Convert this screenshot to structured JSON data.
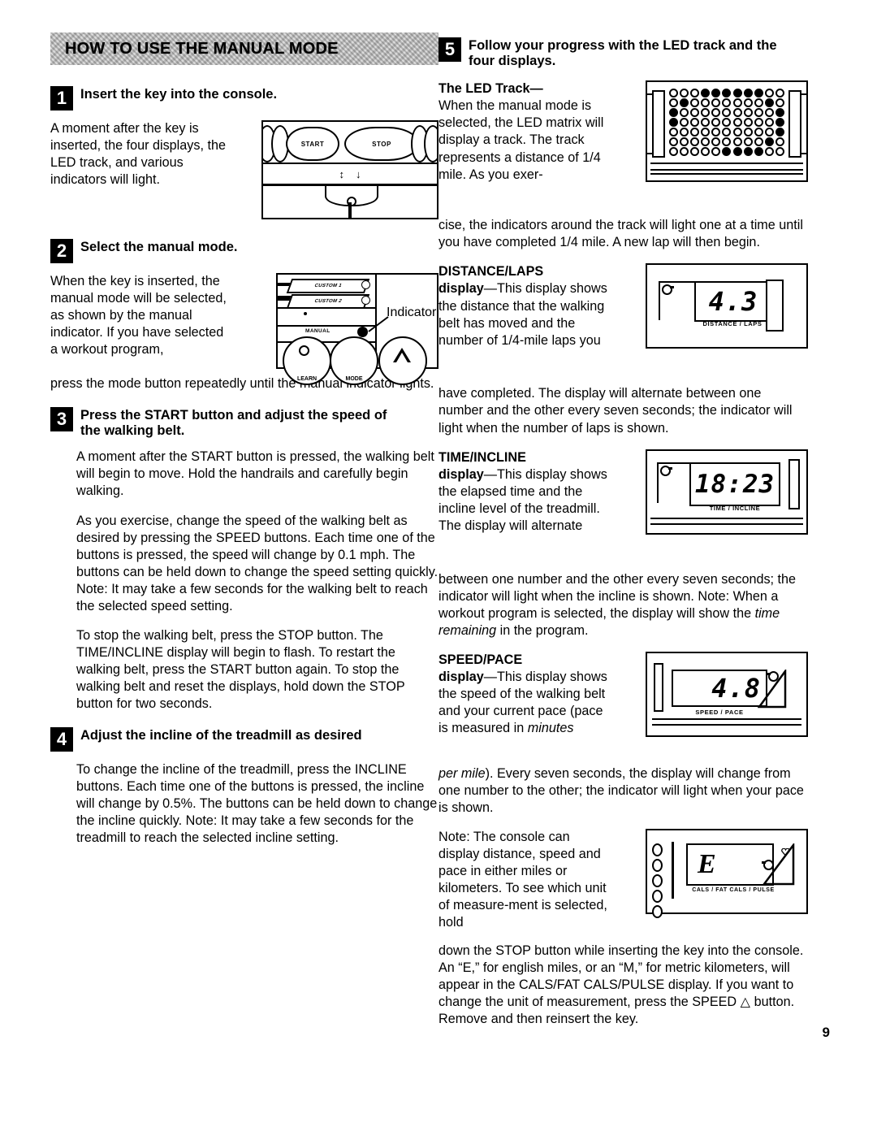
{
  "banner": {
    "title": "HOW TO USE THE MANUAL MODE"
  },
  "page_number": "9",
  "left_column": {
    "step1": {
      "number": "1",
      "title": "Insert the key into the console.",
      "paragraph": "A moment after the key is inserted, the four displays, the LED track, and various indicators will light.",
      "figure": {
        "name": "console-start-stop-figure",
        "start_label": "START",
        "stop_label": "STOP",
        "up_arrow": "↕",
        "down_arrow": "↓"
      }
    },
    "step2": {
      "number": "2",
      "title": "Select the manual mode.",
      "paragraph_narrow": "When the key is inserted, the manual mode will be selected, as shown by the manual indicator. If you have selected a workout program,",
      "paragraph_wide": "press the mode button repeatedly until the manual indicator lights.",
      "figure": {
        "name": "manual-indicator-figure",
        "custom1_label": "CUSTOM 1",
        "custom2_label": "CUSTOM 2",
        "manual_label": "MANUAL",
        "indicator_callout": "Indicator",
        "learn_label": "LEARN",
        "mode_label": "MODE"
      }
    },
    "step3": {
      "number": "3",
      "title": "Press the START button and adjust the speed of the walking belt.",
      "paragraph1": "A moment after the START button is pressed, the walking belt will begin to move. Hold the handrails and carefully begin walking.",
      "paragraph2": "As you exercise, change the speed of the walking belt as desired by pressing the SPEED buttons. Each time one of the buttons is pressed, the speed will change by 0.1 mph. The buttons can be held down to change the speed setting quickly. Note: It may take a few seconds for the walking belt to reach the selected speed setting.",
      "paragraph3": "To stop the walking belt, press the STOP button. The TIME/INCLINE display will begin to flash. To restart the walking belt, press the START button again. To stop the walking belt and reset the displays, hold down the STOP button for two seconds."
    },
    "step4": {
      "number": "4",
      "title": "Adjust the incline of the treadmill as desired",
      "paragraph": "To change the incline of the treadmill, press the INCLINE buttons. Each time one of the buttons is pressed, the incline will change by 0.5%. The buttons can be held down to change the incline quickly. Note: It may take a few seconds for the treadmill to reach the selected incline setting."
    }
  },
  "right_column": {
    "step5": {
      "number": "5",
      "title": "Follow your progress with the LED track and the four displays."
    },
    "led_track": {
      "heading": "The LED Track—",
      "paragraph_narrow": "When the manual mode is selected, the LED matrix will display a track. The track represents a distance of 1/4 mile. As you exer-",
      "paragraph_wide": "cise, the indicators around the track will light one at a time until you have completed 1/4 mile. A new lap will then begin.",
      "figure": {
        "name": "led-matrix-figure",
        "rows": 7,
        "cols": 11,
        "pattern": [
          [
            0,
            0,
            0,
            1,
            1,
            1,
            1,
            1,
            1,
            0,
            0
          ],
          [
            0,
            1,
            0,
            0,
            0,
            0,
            0,
            0,
            0,
            1,
            0
          ],
          [
            1,
            0,
            0,
            0,
            0,
            0,
            0,
            0,
            0,
            0,
            1
          ],
          [
            1,
            0,
            0,
            0,
            0,
            0,
            0,
            0,
            0,
            0,
            1
          ],
          [
            0,
            0,
            0,
            0,
            0,
            0,
            0,
            0,
            0,
            0,
            1
          ],
          [
            0,
            0,
            0,
            0,
            0,
            0,
            0,
            0,
            0,
            1,
            0
          ],
          [
            0,
            0,
            0,
            0,
            0,
            1,
            1,
            1,
            1,
            0,
            0
          ]
        ]
      }
    },
    "distance_laps": {
      "heading": "DISTANCE/LAPS",
      "lead": "display",
      "paragraph_narrow": "—This display shows the distance that the walking belt has moved and the number of 1/4-mile laps you",
      "paragraph_wide": "have completed. The display will alternate between one number and the other every seven seconds; the indicator will light when the number of laps is shown.",
      "figure": {
        "name": "distance-laps-display-figure",
        "value": "4.3",
        "label": "DISTANCE / LAPS"
      }
    },
    "time_incline": {
      "heading": "TIME/INCLINE",
      "lead": "display",
      "paragraph_narrow": "—This display shows the elapsed time and the incline level of the treadmill. The display will alternate",
      "paragraph_wide_a": "between one number and the other every seven seconds; the indicator will light when the incline is shown. Note: When a workout program is selected, the display will show the ",
      "paragraph_italic": "time remaining",
      "paragraph_wide_b": " in the program.",
      "figure": {
        "name": "time-incline-display-figure",
        "value": "18:23",
        "label": "TIME / INCLINE"
      }
    },
    "speed_pace": {
      "heading": "SPEED/PACE",
      "lead": "display",
      "paragraph_narrow_a": "—This display shows the speed of the walking belt and your current pace (pace is measured in ",
      "paragraph_italic_a": "minutes",
      "paragraph_italic_b": "per mile",
      "paragraph_wide": "). Every seven seconds, the display will change from one number to the other; the indicator will light when your pace is shown.",
      "figure": {
        "name": "speed-pace-display-figure",
        "value": "4.8",
        "label": "SPEED / PACE"
      }
    },
    "unit_note": {
      "paragraph_narrow": "Note: The console can display distance, speed and pace in either miles or kilometers. To see which unit of measure-ment is selected, hold",
      "paragraph_wide": "down the STOP button while inserting the key into the console. An “E,” for english miles, or an “M,” for metric kilometers, will appear in the CALS/FAT CALS/PULSE display. If you want to change the unit of measurement, press the SPEED △ button. Remove and then reinsert the key.",
      "figure": {
        "name": "cals-pulse-display-figure",
        "value": "E",
        "label": "CALS / FAT CALS / PULSE"
      }
    }
  }
}
